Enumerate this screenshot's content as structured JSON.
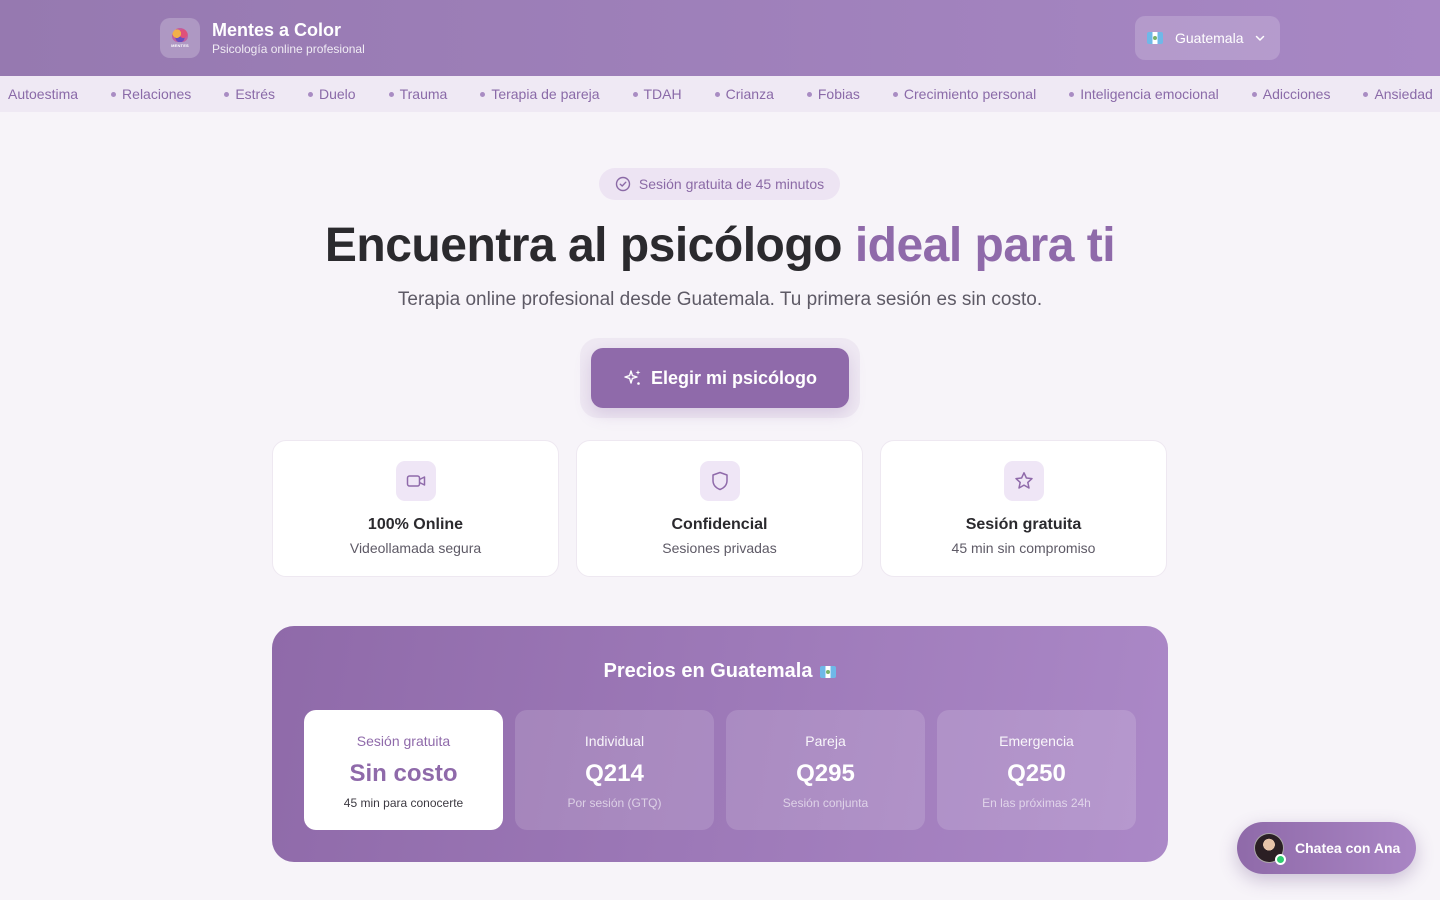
{
  "header": {
    "brand_name": "Mentes a Color",
    "brand_tagline": "Psicología online profesional",
    "logo_text": "MENTES",
    "country": "Guatemala"
  },
  "topics": [
    "Autoestima",
    "Relaciones",
    "Estrés",
    "Duelo",
    "Trauma",
    "Terapia de pareja",
    "TDAH",
    "Crianza",
    "Fobias",
    "Crecimiento personal",
    "Inteligencia emocional",
    "Adicciones",
    "Ansiedad"
  ],
  "hero": {
    "badge": "Sesión gratuita de 45 minutos",
    "title_main": "Encuentra al psicólogo",
    "title_accent": "ideal para ti",
    "subtitle": "Terapia online profesional desde Guatemala. Tu primera sesión es sin costo.",
    "cta": "Elegir mi psicólogo"
  },
  "features": [
    {
      "icon": "video-icon",
      "title": "100% Online",
      "desc": "Videollamada segura"
    },
    {
      "icon": "shield-icon",
      "title": "Confidencial",
      "desc": "Sesiones privadas"
    },
    {
      "icon": "star-icon",
      "title": "Sesión gratuita",
      "desc": "45 min sin compromiso"
    }
  ],
  "pricing": {
    "title": "Precios en Guatemala",
    "cards": [
      {
        "label": "Sesión gratuita",
        "value": "Sin costo",
        "note": "45 min para conocerte",
        "highlight": true
      },
      {
        "label": "Individual",
        "value": "Q214",
        "note": "Por sesión (GTQ)"
      },
      {
        "label": "Pareja",
        "value": "Q295",
        "note": "Sesión conjunta"
      },
      {
        "label": "Emergencia",
        "value": "Q250",
        "note": "En las próximas 24h"
      }
    ]
  },
  "chat": {
    "label": "Chatea con Ana",
    "status": "online"
  },
  "colors": {
    "accent": "#8f6aaa",
    "header_start": "#9679b0",
    "header_end": "#a787c4",
    "online": "#2ecc71"
  }
}
